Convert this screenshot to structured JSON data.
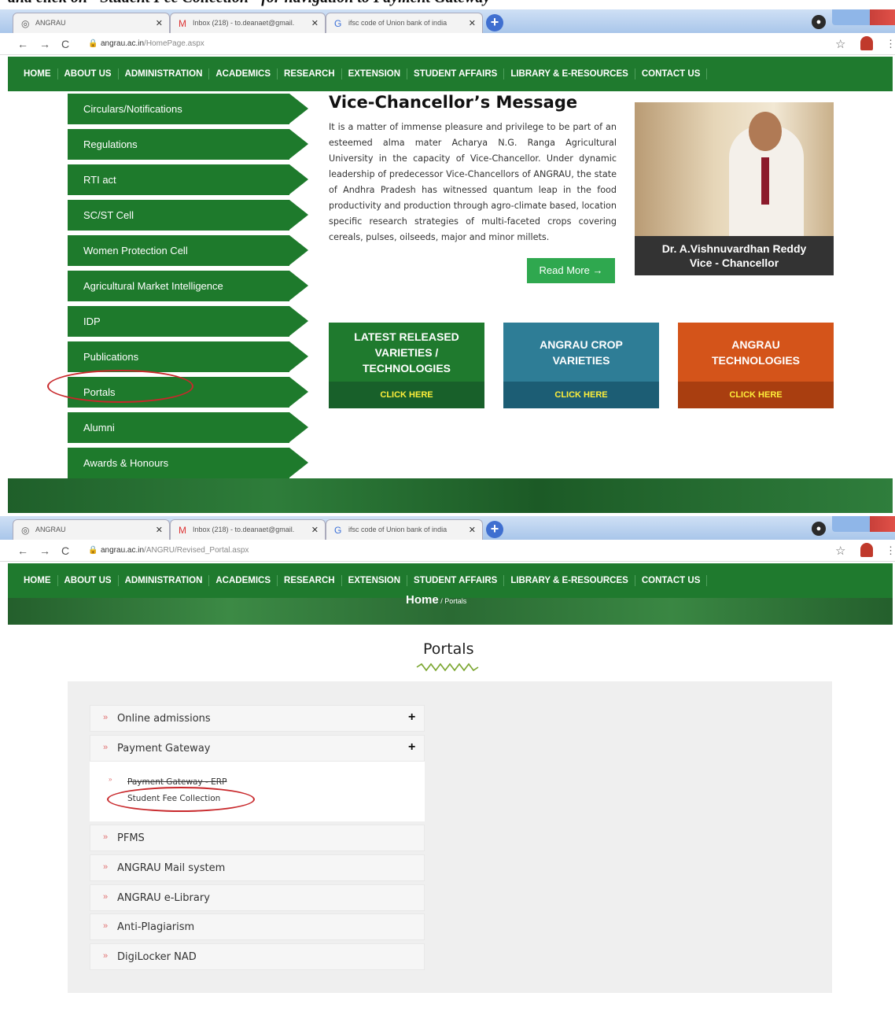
{
  "caption": "and click on \"Student Fee Collection\" for navigation to Payment Gateway",
  "colors": {
    "brand_green": "#1f7a2e",
    "teal": "#2e7d96",
    "orange": "#d4541a",
    "annotation_red": "#c8282b"
  },
  "shot1": {
    "tabs": [
      {
        "label": "ANGRAU",
        "icon": "globe-icon"
      },
      {
        "label": "Inbox (218) - to.deanaet@gmail.",
        "icon": "gmail-icon"
      },
      {
        "label": "ifsc code of Union bank of india",
        "icon": "google-icon"
      }
    ],
    "url_domain": "angrau.ac.in",
    "url_path": "/HomePage.aspx",
    "nav": [
      "HOME",
      "ABOUT US",
      "ADMINISTRATION",
      "ACADEMICS",
      "RESEARCH",
      "EXTENSION",
      "STUDENT AFFAIRS",
      "LIBRARY & E-RESOURCES",
      "CONTACT US"
    ],
    "left_menu": [
      "Circulars/Notifications",
      "Regulations",
      "RTI act",
      "SC/ST Cell",
      "Women Protection Cell",
      "Agricultural Market Intelligence",
      "IDP",
      "Publications",
      "Portals",
      "Alumni",
      "Awards & Honours"
    ],
    "vc": {
      "title": "Vice-Chancellor’s Message",
      "text": "It is a matter of immense pleasure and privilege to be part of an esteemed alma mater Acharya N.G. Ranga Agricultural University in the capacity of Vice-Chancellor. Under dynamic leadership of predecessor Vice-Chancellors of ANGRAU, the state of Andhra Pradesh has witnessed quantum leap in the food productivity and production through agro-climate based, location specific research strategies of multi-faceted crops covering cereals, pulses, oilseeds, major and minor millets.",
      "read_more": "Read More →",
      "name": "Dr. A.Vishnuvardhan Reddy",
      "designation": "Vice - Chancellor"
    },
    "boxes": [
      {
        "title": "LATEST RELEASED VARIETIES / TECHNOLOGIES",
        "cta": "CLICK HERE"
      },
      {
        "title": "ANGRAU CROP VARIETIES",
        "cta": "CLICK HERE"
      },
      {
        "title": "ANGRAU TECHNOLOGIES",
        "cta": "CLICK HERE"
      }
    ]
  },
  "shot2": {
    "tabs": [
      {
        "label": "ANGRAU",
        "icon": "globe-icon"
      },
      {
        "label": "Inbox (218) - to.deanaet@gmail.",
        "icon": "gmail-icon"
      },
      {
        "label": "ifsc code of Union bank of india",
        "icon": "google-icon"
      }
    ],
    "url_domain": "angrau.ac.in",
    "url_path": "/ANGRU/Revised_Portal.aspx",
    "nav": [
      "HOME",
      "ABOUT US",
      "ADMINISTRATION",
      "ACADEMICS",
      "RESEARCH",
      "EXTENSION",
      "STUDENT AFFAIRS",
      "LIBRARY & E-RESOURCES",
      "CONTACT US"
    ],
    "breadcrumb": {
      "home": "Home",
      "sep": " / ",
      "current": "Portals"
    },
    "title": "Portals",
    "accordion": [
      {
        "label": "Online admissions",
        "expand": "+"
      },
      {
        "label": "Payment Gateway",
        "expand": "+"
      }
    ],
    "sub_items": [
      "Payment Gateway - ERP",
      "Student Fee Collection"
    ],
    "accordion_rest": [
      "PFMS",
      "ANGRAU Mail system",
      "ANGRAU e-Library",
      "Anti-Plagiarism",
      "DigiLocker NAD"
    ]
  }
}
